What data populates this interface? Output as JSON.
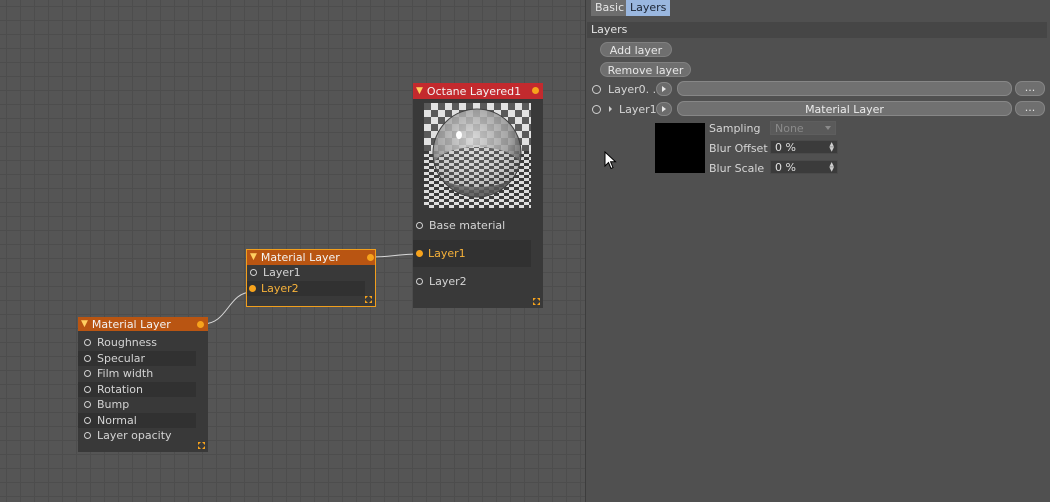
{
  "canvas": {
    "octane_node": {
      "title": "Octane Layered1",
      "inputs": [
        "Base material",
        "Layer1",
        "Layer2"
      ],
      "active_input": "Layer1",
      "header_color": "#c32a2e"
    },
    "material_layer_1": {
      "title": "Material Layer",
      "inputs": [
        "Layer1",
        "Layer2"
      ],
      "active_input": "Layer2",
      "header_color": "#b95512"
    },
    "material_layer_2": {
      "title": "Material Layer",
      "inputs": [
        "Roughness",
        "Specular",
        "Film width",
        "Rotation",
        "Bump",
        "Normal",
        "Layer opacity"
      ],
      "header_color": "#b95512"
    },
    "port_color": "#f7a31c"
  },
  "panel": {
    "tabs": [
      {
        "label": "Basic",
        "active": false
      },
      {
        "label": "Layers",
        "active": true
      }
    ],
    "section_title": "Layers",
    "add_layer_label": "Add layer",
    "remove_layer_label": "Remove layer",
    "layers": [
      {
        "name": "Layer0. .",
        "material": "",
        "more": "..."
      },
      {
        "name": "Layer1",
        "material": "Material Layer",
        "more": "..."
      }
    ],
    "props": {
      "sampling_label": "Sampling",
      "sampling_value": "None",
      "blur_offset_label": "Blur Offset",
      "blur_offset_value": "0 %",
      "blur_scale_label": "Blur Scale",
      "blur_scale_value": "0 %"
    },
    "tab_active_color": "#9ab7df"
  }
}
